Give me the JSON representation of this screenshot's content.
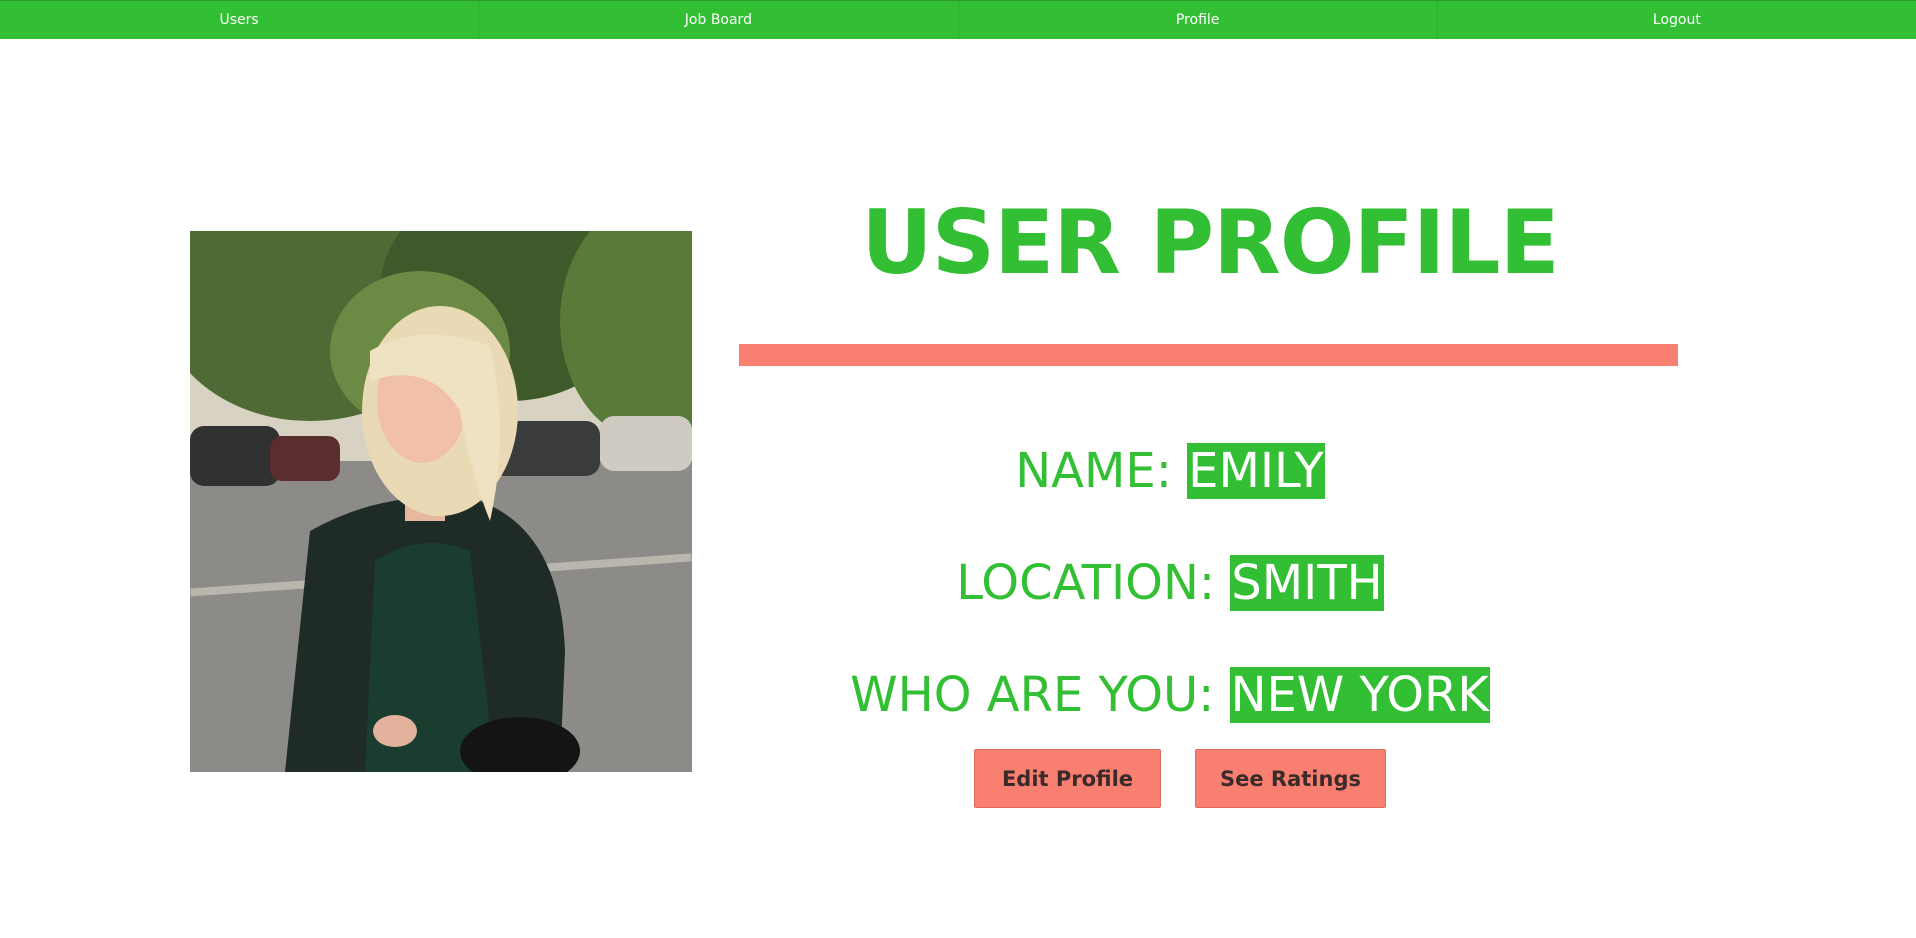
{
  "nav": {
    "items": [
      {
        "label": "Users"
      },
      {
        "label": "Job Board"
      },
      {
        "label": "Profile"
      },
      {
        "label": "Logout"
      }
    ]
  },
  "profile": {
    "title": "USER PROFILE",
    "rows": [
      {
        "label": "NAME: ",
        "value": "EMILY"
      },
      {
        "label": "LOCATION: ",
        "value": "SMITH"
      },
      {
        "label": "WHO ARE YOU: ",
        "value": "NEW YORK"
      }
    ],
    "edit_label": "Edit Profile",
    "ratings_label": "See Ratings"
  },
  "colors": {
    "primary_green": "#33bf33",
    "accent_salmon": "#f97f70"
  }
}
